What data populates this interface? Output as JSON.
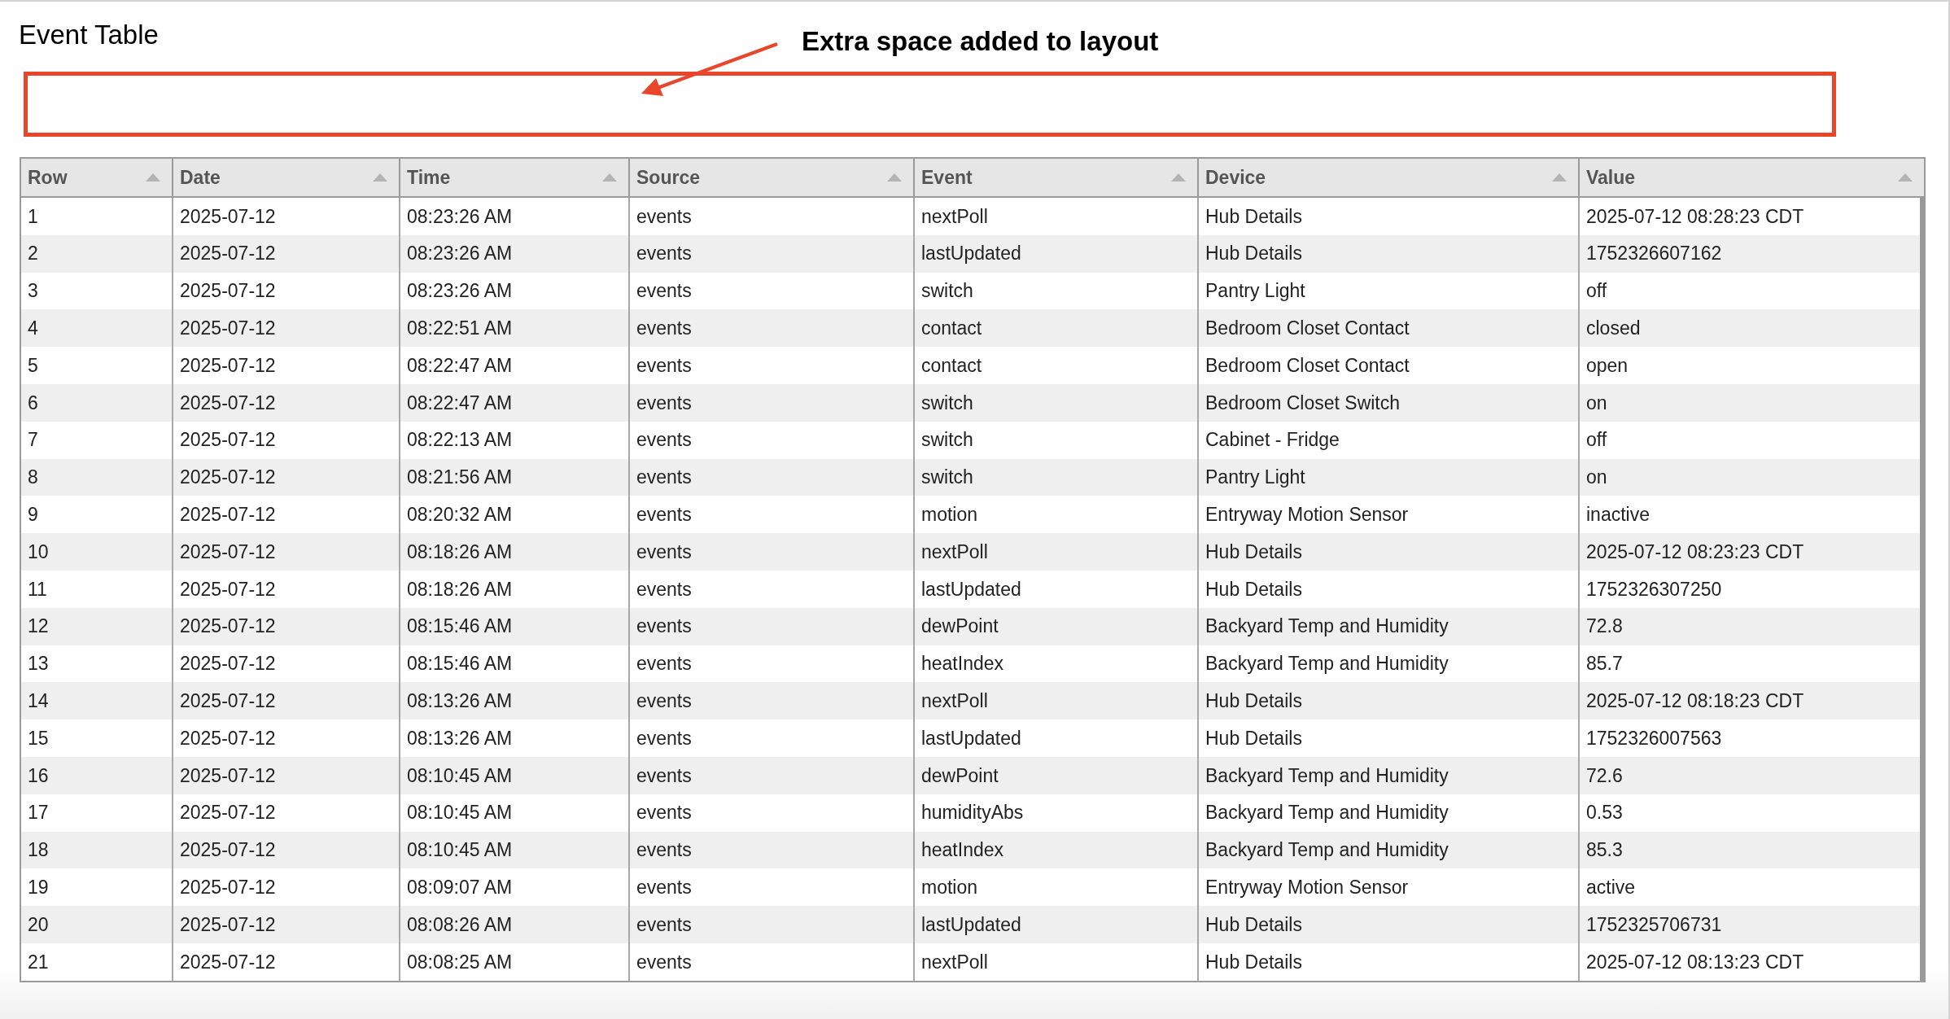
{
  "title": "Event Table",
  "annotation": {
    "text": "Extra space added to layout"
  },
  "table": {
    "columns": [
      "Row",
      "Date",
      "Time",
      "Source",
      "Event",
      "Device",
      "Value"
    ],
    "rows": [
      [
        "1",
        "2025-07-12",
        "08:23:26 AM",
        "events",
        "nextPoll",
        "Hub Details",
        "2025-07-12 08:28:23 CDT"
      ],
      [
        "2",
        "2025-07-12",
        "08:23:26 AM",
        "events",
        "lastUpdated",
        "Hub Details",
        "1752326607162"
      ],
      [
        "3",
        "2025-07-12",
        "08:23:26 AM",
        "events",
        "switch",
        "Pantry Light",
        "off"
      ],
      [
        "4",
        "2025-07-12",
        "08:22:51 AM",
        "events",
        "contact",
        "Bedroom Closet Contact",
        "closed"
      ],
      [
        "5",
        "2025-07-12",
        "08:22:47 AM",
        "events",
        "contact",
        "Bedroom Closet Contact",
        "open"
      ],
      [
        "6",
        "2025-07-12",
        "08:22:47 AM",
        "events",
        "switch",
        "Bedroom Closet Switch",
        "on"
      ],
      [
        "7",
        "2025-07-12",
        "08:22:13 AM",
        "events",
        "switch",
        "Cabinet - Fridge",
        "off"
      ],
      [
        "8",
        "2025-07-12",
        "08:21:56 AM",
        "events",
        "switch",
        "Pantry Light",
        "on"
      ],
      [
        "9",
        "2025-07-12",
        "08:20:32 AM",
        "events",
        "motion",
        "Entryway Motion Sensor",
        "inactive"
      ],
      [
        "10",
        "2025-07-12",
        "08:18:26 AM",
        "events",
        "nextPoll",
        "Hub Details",
        "2025-07-12 08:23:23 CDT"
      ],
      [
        "11",
        "2025-07-12",
        "08:18:26 AM",
        "events",
        "lastUpdated",
        "Hub Details",
        "1752326307250"
      ],
      [
        "12",
        "2025-07-12",
        "08:15:46 AM",
        "events",
        "dewPoint",
        "Backyard Temp and Humidity",
        "72.8"
      ],
      [
        "13",
        "2025-07-12",
        "08:15:46 AM",
        "events",
        "heatIndex",
        "Backyard Temp and Humidity",
        "85.7"
      ],
      [
        "14",
        "2025-07-12",
        "08:13:26 AM",
        "events",
        "nextPoll",
        "Hub Details",
        "2025-07-12 08:18:23 CDT"
      ],
      [
        "15",
        "2025-07-12",
        "08:13:26 AM",
        "events",
        "lastUpdated",
        "Hub Details",
        "1752326007563"
      ],
      [
        "16",
        "2025-07-12",
        "08:10:45 AM",
        "events",
        "dewPoint",
        "Backyard Temp and Humidity",
        "72.6"
      ],
      [
        "17",
        "2025-07-12",
        "08:10:45 AM",
        "events",
        "humidityAbs",
        "Backyard Temp and Humidity",
        "0.53"
      ],
      [
        "18",
        "2025-07-12",
        "08:10:45 AM",
        "events",
        "heatIndex",
        "Backyard Temp and Humidity",
        "85.3"
      ],
      [
        "19",
        "2025-07-12",
        "08:09:07 AM",
        "events",
        "motion",
        "Entryway Motion Sensor",
        "active"
      ],
      [
        "20",
        "2025-07-12",
        "08:08:26 AM",
        "events",
        "lastUpdated",
        "Hub Details",
        "1752325706731"
      ],
      [
        "21",
        "2025-07-12",
        "08:08:25 AM",
        "events",
        "nextPoll",
        "Hub Details",
        "2025-07-12 08:13:23 CDT"
      ]
    ]
  }
}
